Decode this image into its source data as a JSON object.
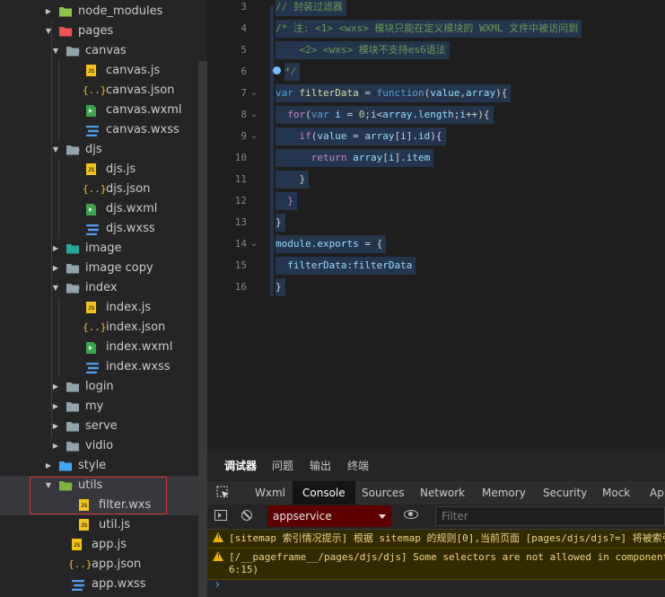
{
  "explorer": {
    "items": [
      {
        "label": "node_modules",
        "kind": "folder",
        "icon": "node-modules-folder-icon"
      },
      {
        "label": "pages",
        "kind": "folder",
        "icon": "pages-folder-icon"
      },
      {
        "label": "canvas",
        "kind": "folder",
        "icon": "folder-open-icon"
      },
      {
        "label": "canvas.js",
        "kind": "js",
        "icon": "js-file-icon"
      },
      {
        "label": "canvas.json",
        "kind": "json",
        "icon": "json-file-icon"
      },
      {
        "label": "canvas.wxml",
        "kind": "wxml",
        "icon": "wxml-file-icon"
      },
      {
        "label": "canvas.wxss",
        "kind": "wxss",
        "icon": "wxss-file-icon"
      },
      {
        "label": "djs",
        "kind": "folder",
        "icon": "folder-open-icon"
      },
      {
        "label": "djs.js",
        "kind": "js",
        "icon": "js-file-icon"
      },
      {
        "label": "djs.json",
        "kind": "json",
        "icon": "json-file-icon"
      },
      {
        "label": "djs.wxml",
        "kind": "wxml",
        "icon": "wxml-file-icon"
      },
      {
        "label": "djs.wxss",
        "kind": "wxss",
        "icon": "wxss-file-icon"
      },
      {
        "label": "image",
        "kind": "folder",
        "icon": "image-folder-icon"
      },
      {
        "label": "image copy",
        "kind": "folder",
        "icon": "folder-icon"
      },
      {
        "label": "index",
        "kind": "folder",
        "icon": "folder-open-icon"
      },
      {
        "label": "index.js",
        "kind": "js",
        "icon": "js-file-icon"
      },
      {
        "label": "index.json",
        "kind": "json",
        "icon": "json-file-icon"
      },
      {
        "label": "index.wxml",
        "kind": "wxml",
        "icon": "wxml-file-icon"
      },
      {
        "label": "index.wxss",
        "kind": "wxss",
        "icon": "wxss-file-icon"
      },
      {
        "label": "login",
        "kind": "folder",
        "icon": "folder-icon"
      },
      {
        "label": "my",
        "kind": "folder",
        "icon": "folder-icon"
      },
      {
        "label": "serve",
        "kind": "folder",
        "icon": "folder-icon"
      },
      {
        "label": "vidio",
        "kind": "folder",
        "icon": "folder-icon"
      },
      {
        "label": "style",
        "kind": "folder",
        "icon": "style-folder-icon"
      },
      {
        "label": "utils",
        "kind": "folder",
        "icon": "utils-folder-icon"
      },
      {
        "label": "filter.wxs",
        "kind": "js",
        "icon": "js-file-icon"
      },
      {
        "label": "util.js",
        "kind": "js",
        "icon": "js-file-icon"
      },
      {
        "label": "app.js",
        "kind": "js",
        "icon": "js-file-icon"
      },
      {
        "label": "app.json",
        "kind": "json",
        "icon": "json-file-icon"
      },
      {
        "label": "app.wxss",
        "kind": "wxss",
        "icon": "wxss-file-icon"
      }
    ]
  },
  "editor": {
    "line_numbers": [
      "3",
      "4",
      "5",
      "6",
      "7",
      "8",
      "9",
      "10",
      "11",
      "12",
      "13",
      "14",
      "15",
      "16"
    ],
    "lines": [
      [
        {
          "t": "// 封装过滤器",
          "c": "cm"
        }
      ],
      [
        {
          "t": "/* 注: <1> <wxs> 模块只能在定义模块的 WXML 文件中被访问到",
          "c": "cm"
        }
      ],
      [
        {
          "t": "    <2> <wxs> 模块不支持es6语法",
          "c": "cm"
        }
      ],
      [
        {
          "t": "*/",
          "c": "cm"
        }
      ],
      [
        {
          "t": "var ",
          "c": "kw"
        },
        {
          "t": "filterData",
          "c": "fn"
        },
        {
          "t": " = ",
          "c": "op"
        },
        {
          "t": "function",
          "c": "kw"
        },
        {
          "t": "(",
          "c": "op"
        },
        {
          "t": "value",
          "c": "id"
        },
        {
          "t": ",",
          "c": "op"
        },
        {
          "t": "array",
          "c": "id"
        },
        {
          "t": "){",
          "c": "op"
        }
      ],
      [
        {
          "t": "  ",
          "c": "op"
        },
        {
          "t": "for",
          "c": "pm"
        },
        {
          "t": "(",
          "c": "op"
        },
        {
          "t": "var ",
          "c": "kw"
        },
        {
          "t": "i",
          "c": "id"
        },
        {
          "t": " = ",
          "c": "op"
        },
        {
          "t": "0",
          "c": "num"
        },
        {
          "t": ";",
          "c": "op"
        },
        {
          "t": "i",
          "c": "id"
        },
        {
          "t": "<",
          "c": "op"
        },
        {
          "t": "array",
          "c": "id"
        },
        {
          "t": ".",
          "c": "op"
        },
        {
          "t": "length",
          "c": "id"
        },
        {
          "t": ";",
          "c": "op"
        },
        {
          "t": "i",
          "c": "id"
        },
        {
          "t": "++){",
          "c": "op"
        }
      ],
      [
        {
          "t": "    ",
          "c": "op"
        },
        {
          "t": "if",
          "c": "pm"
        },
        {
          "t": "(",
          "c": "op"
        },
        {
          "t": "value",
          "c": "id"
        },
        {
          "t": " = ",
          "c": "op"
        },
        {
          "t": "array",
          "c": "id"
        },
        {
          "t": "[",
          "c": "op"
        },
        {
          "t": "i",
          "c": "id"
        },
        {
          "t": "].",
          "c": "op"
        },
        {
          "t": "id",
          "c": "id"
        },
        {
          "t": "){",
          "c": "op"
        }
      ],
      [
        {
          "t": "      ",
          "c": "op"
        },
        {
          "t": "return ",
          "c": "pm"
        },
        {
          "t": "array",
          "c": "id"
        },
        {
          "t": "[",
          "c": "op"
        },
        {
          "t": "i",
          "c": "id"
        },
        {
          "t": "].",
          "c": "op"
        },
        {
          "t": "item",
          "c": "id"
        }
      ],
      [
        {
          "t": "    }",
          "c": "op"
        }
      ],
      [
        {
          "t": "  }",
          "c": "pm"
        }
      ],
      [
        {
          "t": "}",
          "c": "op"
        }
      ],
      [
        {
          "t": "module",
          "c": "id"
        },
        {
          "t": ".",
          "c": "op"
        },
        {
          "t": "exports",
          "c": "id"
        },
        {
          "t": " = {",
          "c": "op"
        }
      ],
      [
        {
          "t": "  ",
          "c": "op"
        },
        {
          "t": "filterData",
          "c": "id"
        },
        {
          "t": ":",
          "c": "op"
        },
        {
          "t": "filterData",
          "c": "id"
        }
      ],
      [
        {
          "t": "}",
          "c": "op"
        }
      ]
    ]
  },
  "panel": {
    "tabs": [
      "调试器",
      "问题",
      "输出",
      "终端"
    ],
    "active_tab": "调试器",
    "devtools_tabs": [
      "Wxml",
      "Console",
      "Sources",
      "Network",
      "Memory",
      "Security",
      "Mock",
      "AppData"
    ],
    "active_devtools_tab": "Console",
    "context_select": "appservice",
    "filter_placeholder": "Filter",
    "messages": [
      {
        "level": "warning",
        "lines": [
          "[sitemap 索引情况提示] 根据 sitemap 的规则[0],当前页面 [pages/djs/djs?=] 将被索引"
        ]
      },
      {
        "level": "warning",
        "lines": [
          "[/__pageframe__/pages/djs/djs] Some selectors are not allowed in component wxss",
          "6:15)"
        ]
      }
    ],
    "prompt": "›"
  },
  "colors": {
    "accent": "#0e639c",
    "warning_bg": "#332b00",
    "warning_text": "#f2d48a",
    "selection_box": "#d9362f",
    "context_bg": "#5e0000"
  }
}
